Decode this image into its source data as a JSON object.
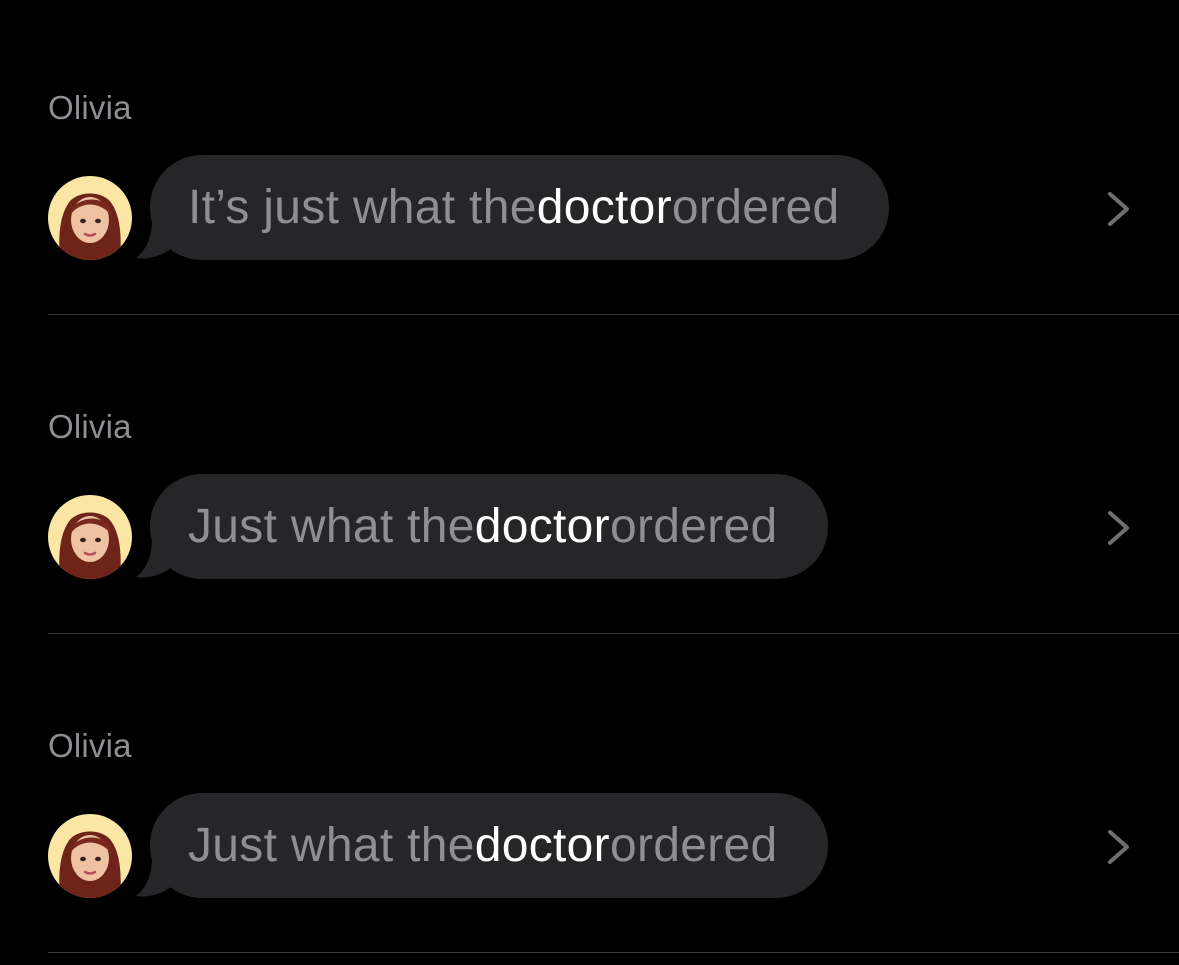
{
  "results": [
    {
      "sender": "Olivia",
      "before": "It’s just what the ",
      "highlight": "doctor",
      "after": " ordered"
    },
    {
      "sender": "Olivia",
      "before": "Just what the ",
      "highlight": "doctor",
      "after": " ordered"
    },
    {
      "sender": "Olivia",
      "before": "Just what the ",
      "highlight": "doctor",
      "after": " ordered"
    }
  ],
  "colors": {
    "background": "#000000",
    "bubble": "#262628",
    "text_muted": "#8e8e93",
    "text_highlight": "#ffffff",
    "avatar_bg": "#fbe6a6",
    "divider": "#38383a"
  },
  "icons": {
    "avatar": "memoji-avatar-icon",
    "chevron": "chevron-right-icon"
  }
}
